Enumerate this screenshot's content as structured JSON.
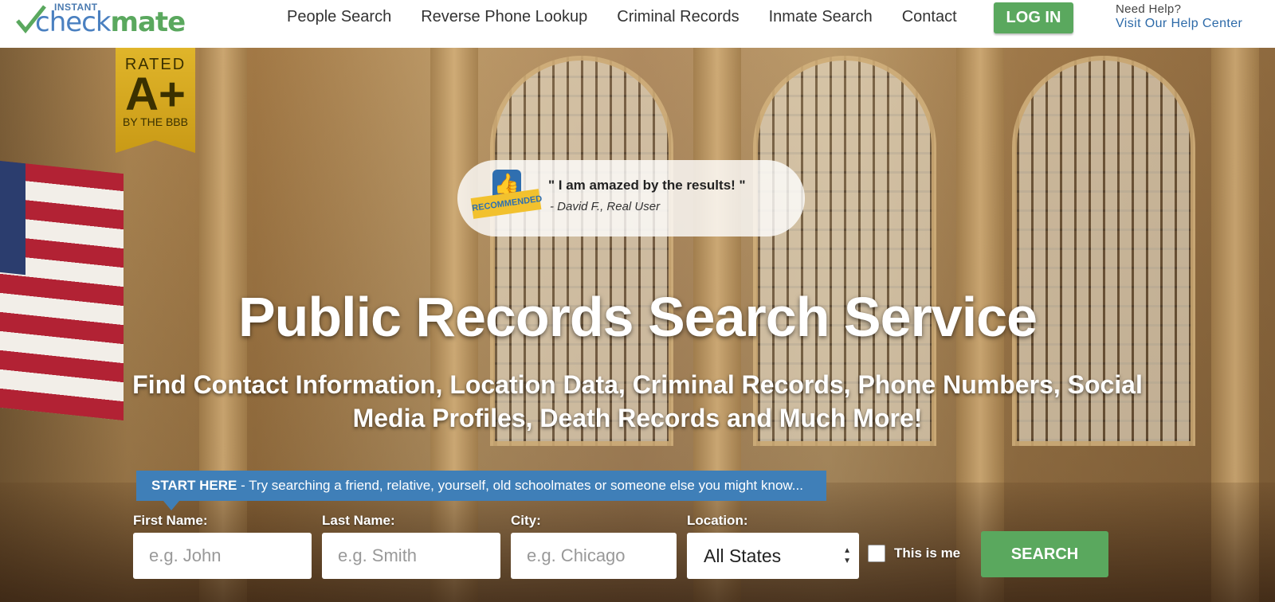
{
  "logo": {
    "small": "INSTANT",
    "word1": "check",
    "word2": "mate"
  },
  "nav": {
    "items": [
      "People Search",
      "Reverse Phone Lookup",
      "Criminal Records",
      "Inmate Search",
      "Contact"
    ]
  },
  "login": "LOG IN",
  "help": {
    "question": "Need Help?",
    "link": "Visit Our Help Center"
  },
  "badge": {
    "rated": "RATED",
    "grade": "A+",
    "by": "BY THE BBB"
  },
  "testimonial": {
    "badge": "RECOMMENDED",
    "quote": "\" I am amazed by the results! \"",
    "author": "- David F., Real User"
  },
  "hero": {
    "title": "Public Records Search Service",
    "subtitle": "Find Contact Information, Location Data, Criminal Records, Phone Numbers, Social Media Profiles, Death Records and Much More!"
  },
  "tip": {
    "lead": "START HERE",
    "text": " - Try searching a friend, relative, yourself, old schoolmates or someone else you might know..."
  },
  "form": {
    "first": {
      "label": "First Name:",
      "placeholder": "e.g. John"
    },
    "last": {
      "label": "Last Name:",
      "placeholder": "e.g. Smith"
    },
    "city": {
      "label": "City:",
      "placeholder": "e.g. Chicago"
    },
    "location": {
      "label": "Location:",
      "value": "All States"
    },
    "checkbox": "This is me",
    "submit": "SEARCH"
  },
  "colors": {
    "green": "#5aa85e",
    "blue": "#3f7fb8",
    "gold": "#d9ad22"
  }
}
